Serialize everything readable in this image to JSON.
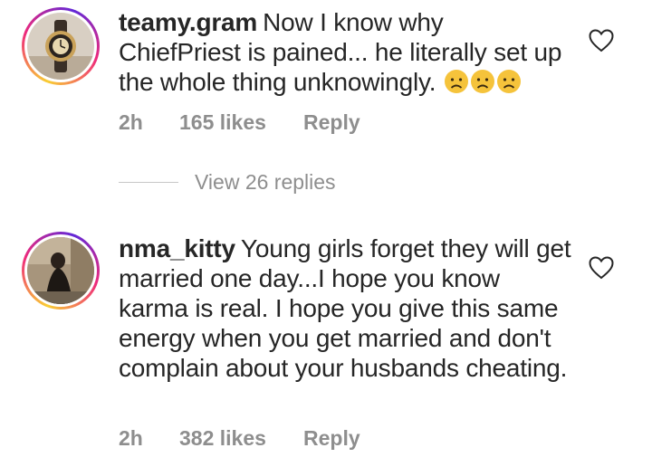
{
  "comments": [
    {
      "username": "teamy.gram",
      "text": "Now I know why ChiefPriest is pained... he literally set up the whole thing unknowingly.",
      "emojis": [
        "sad-face-icon",
        "sad-face-icon",
        "sad-face-icon"
      ],
      "time": "2h",
      "likes": "165 likes",
      "reply_label": "Reply"
    },
    {
      "username": "nma_kitty",
      "text": "Young girls forget they will get married one day...I hope you know karma is real. I hope you give this same energy when you get married and don't complain about your husbands cheating.",
      "time": "2h",
      "likes": "382 likes",
      "reply_label": "Reply"
    }
  ],
  "view_replies": "View 26 replies",
  "colors": {
    "text": "#262626",
    "meta": "#8e8e8e",
    "emoji": "#f5c33b"
  }
}
